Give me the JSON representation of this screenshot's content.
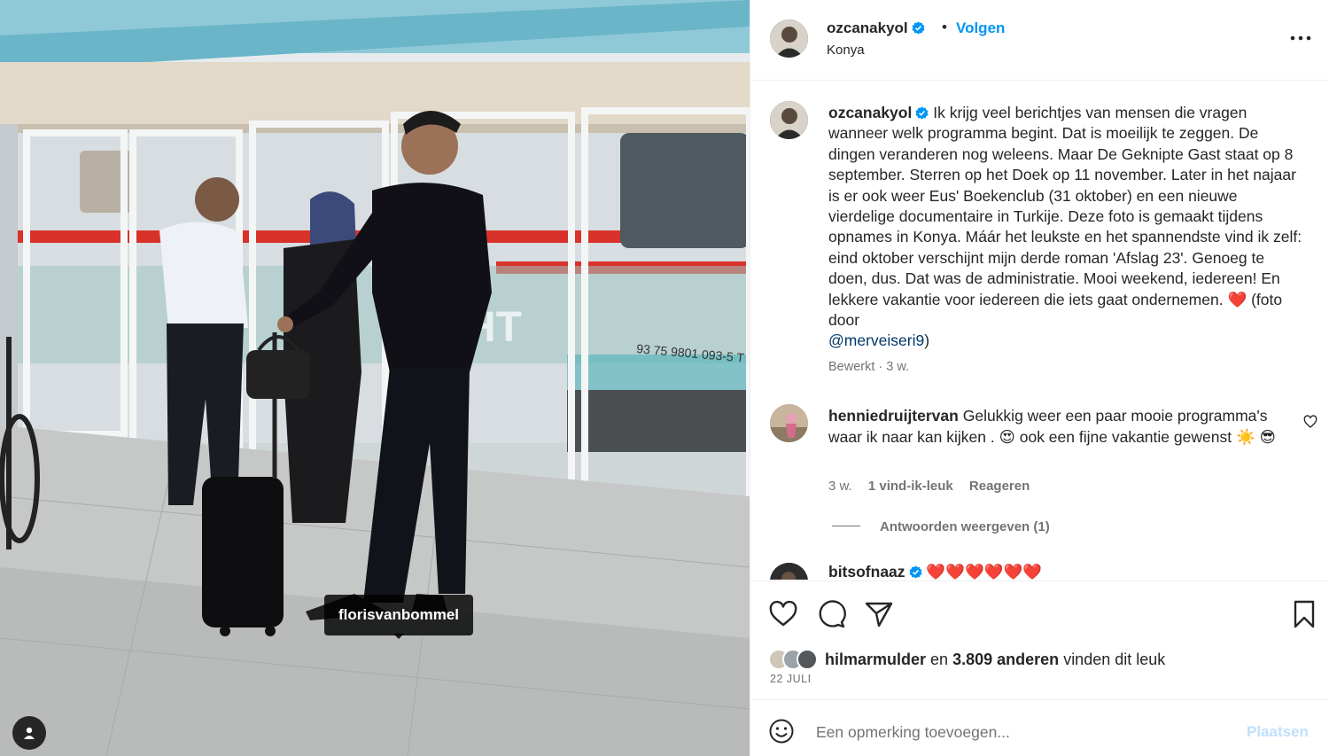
{
  "post": {
    "username": "ozcanakyol",
    "follow_label": "Volgen",
    "separator": "•",
    "location": "Konya",
    "photo_tag": "florisvanbommel"
  },
  "caption": {
    "username": "ozcanakyol",
    "text_before_heart": "Ik krijg veel berichtjes van mensen die vragen wanneer welk programma begint. Dat is moeilijk te zeggen. De dingen veranderen nog weleens. Maar De Geknipte Gast staat op 8 september. Sterren op het Doek op 11 november. Later in het najaar is er ook weer Eus' Boekenclub (31 oktober) en een nieuwe vierdelige documentaire in Turkije. Deze foto is gemaakt tijdens opnames in Konya. Máár het leukste en het spannendste vind ik zelf: eind oktober verschijnt mijn derde roman 'Afslag 23'. Genoeg te doen, dus. Dat was de administratie. Mooi weekend, iedereen! En lekkere vakantie voor iedereen die iets gaat ondernemen.",
    "heart_emoji": "❤️",
    "text_after_heart": "(foto door",
    "mention": "@merveiseri9",
    "text_end": ")",
    "meta": "Bewerkt · 3 w."
  },
  "comments": [
    {
      "username": "henniedruijtervan",
      "text": "Gelukkig weer een paar mooie programma's waar ik naar kan kijken .",
      "emoji1": "😍",
      "text2": "ook een fijne vakantie gewenst",
      "emoji2": "☀️",
      "emoji3": "😎",
      "time": "3 w.",
      "likes": "1 vind-ik-leuk",
      "reply_label": "Reageren",
      "view_replies": "Antwoorden weergeven (1)"
    },
    {
      "username": "bitsofnaaz",
      "text": "❤️❤️❤️❤️❤️❤️"
    }
  ],
  "likes": {
    "first_user": "hilmarmulder",
    "connector": "en",
    "others": "3.809 anderen",
    "suffix": "vinden dit leuk"
  },
  "date": "22 JULI",
  "add_comment": {
    "placeholder": "Een opmerking toevoegen...",
    "post_label": "Plaatsen"
  },
  "colors": {
    "accent": "#0095f6",
    "link": "#00376b",
    "muted": "#737373",
    "heart": "#ed4956"
  },
  "icons": {
    "more": "more-dots-icon",
    "like": "heart-icon",
    "comment": "comment-bubble-icon",
    "share": "paper-plane-icon",
    "save": "bookmark-icon",
    "emoji": "smiley-icon",
    "verified": "verified-badge-icon",
    "user_tag": "user-tag-icon"
  }
}
